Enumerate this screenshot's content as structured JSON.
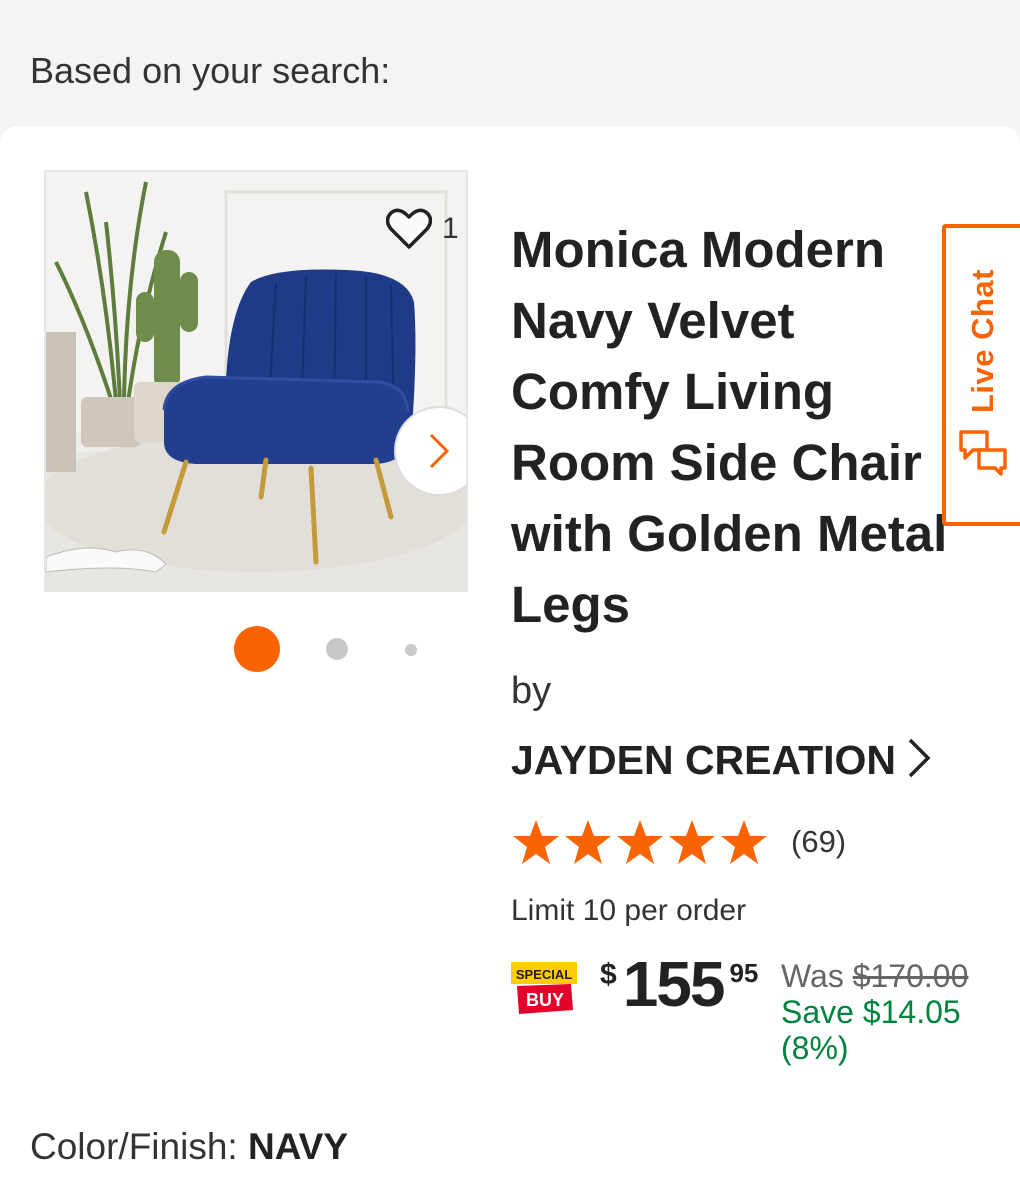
{
  "header": {
    "text": "Based on your search:"
  },
  "product": {
    "favorite_count": "1",
    "title": "Monica Modern\nNavy Velvet\nComfy Living\nRoom Side Chair\nwith Golden Metal\nLegs",
    "by_label": "by",
    "brand": "JAYDEN CREATION",
    "rating": 5,
    "review_count": "(69)",
    "limit": "Limit 10 per order",
    "image_carousel": {
      "active_index": 0,
      "count": 3
    }
  },
  "badge": {
    "line1": "SPECIAL",
    "line2": "BUY"
  },
  "pricing": {
    "currency": "$",
    "dollars": "155",
    "cents": "95",
    "was_label": "Was",
    "was_price": "$170.00",
    "save": "Save $14.05",
    "save_pct": "(8%)"
  },
  "live_chat": {
    "label": "Live Chat"
  },
  "options": {
    "color_label": "Color/Finish:",
    "color_value": "NAVY"
  },
  "colors": {
    "accent": "#f96302",
    "save_green": "#00843d",
    "special_yellow": "#ffcc00",
    "special_red": "#e4002b"
  },
  "icons": [
    "heart-icon",
    "chevron-right-icon",
    "chat-bubbles-icon",
    "star-icon"
  ]
}
